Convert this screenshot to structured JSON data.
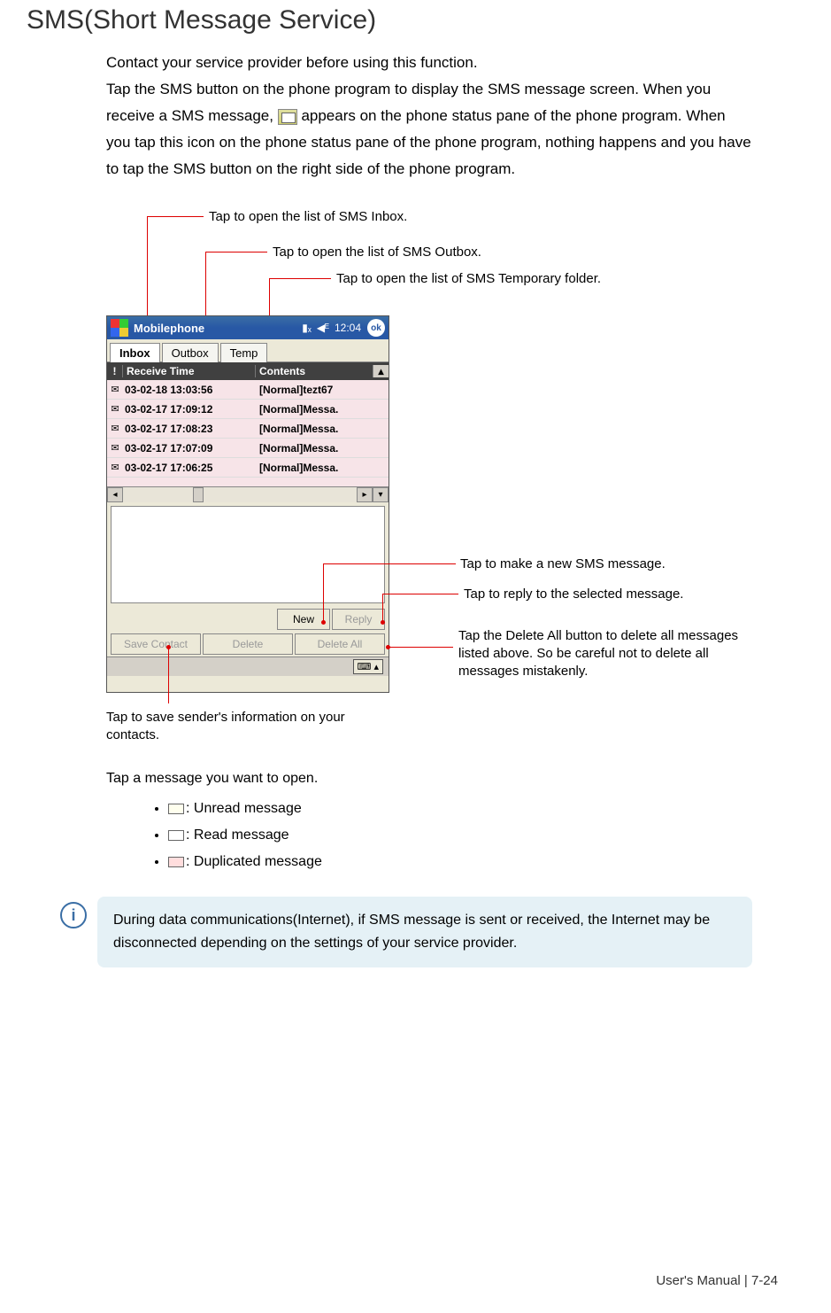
{
  "page": {
    "title": "SMS(Short Message Service)",
    "body_html_parts": [
      "Contact your service provider before using this function.",
      "Tap the SMS button on the phone program to display the SMS message screen. When you receive a SMS message, ",
      "appears on the phone status pane of the phone program. When you tap this icon on the phone status pane of the phone program, nothing happens and you have to tap the SMS button on the right side of the phone program."
    ]
  },
  "callouts": {
    "inbox": "Tap to open the list of SMS Inbox.",
    "outbox": "Tap to open the list of SMS Outbox.",
    "temp": "Tap to open the list of SMS Temporary folder.",
    "new": "Tap to make a new SMS message.",
    "reply": "Tap to reply to the selected message.",
    "delete_all": "Tap the Delete All button to delete all messages listed above. So be careful not to delete all messages mistakenly.",
    "save_contact": "Tap to save sender's information on your contacts."
  },
  "device": {
    "title": "Mobilephone",
    "time": "12:04",
    "ok": "ok",
    "tabs": {
      "inbox": "Inbox",
      "outbox": "Outbox",
      "temp": "Temp"
    },
    "headers": {
      "bang": "!",
      "receive_time": "Receive Time",
      "contents": "Contents"
    },
    "rows": [
      {
        "time": "03-02-18 13:03:56",
        "content": "[Normal]tezt67"
      },
      {
        "time": "03-02-17 17:09:12",
        "content": "[Normal]Messa."
      },
      {
        "time": "03-02-17 17:08:23",
        "content": "[Normal]Messa."
      },
      {
        "time": "03-02-17 17:07:09",
        "content": "[Normal]Messa."
      },
      {
        "time": "03-02-17 17:06:25",
        "content": "[Normal]Messa."
      }
    ],
    "buttons": {
      "new": "New",
      "reply": "Reply",
      "save_contact": "Save Contact",
      "delete": "Delete",
      "delete_all": "Delete All"
    },
    "sip": "⌨ ▴"
  },
  "lower": {
    "tap_msg": "Tap a message you want to open.",
    "bullets": {
      "unread": ": Unread message",
      "read": ": Read message",
      "dup": ": Duplicated message"
    },
    "note": "During data communications(Internet), if SMS message is sent or received, the Internet may be disconnected depending on the settings of your service provider."
  },
  "footer": "User's Manual  |  7-24"
}
